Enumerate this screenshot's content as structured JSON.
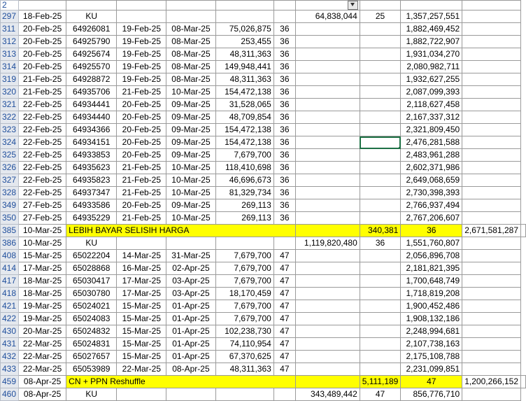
{
  "header_row": {
    "row_num": "2"
  },
  "rows": [
    {
      "num": "297",
      "c1": "18-Feb-25",
      "c2": "KU",
      "c3": "",
      "c4": "",
      "c5": "",
      "c6": "",
      "c7": "64,838,044",
      "c8": "25",
      "c9": "1,357,257,551",
      "hl": false
    },
    {
      "num": "311",
      "c1": "20-Feb-25",
      "c2": "64926081",
      "c3": "19-Feb-25",
      "c4": "08-Mar-25",
      "c5": "75,026,875",
      "c6": "36",
      "c7": "",
      "c8": "",
      "c9": "1,882,469,452",
      "hl": false
    },
    {
      "num": "312",
      "c1": "20-Feb-25",
      "c2": "64925790",
      "c3": "19-Feb-25",
      "c4": "08-Mar-25",
      "c5": "253,455",
      "c6": "36",
      "c7": "",
      "c8": "",
      "c9": "1,882,722,907",
      "hl": false
    },
    {
      "num": "313",
      "c1": "20-Feb-25",
      "c2": "64925674",
      "c3": "19-Feb-25",
      "c4": "08-Mar-25",
      "c5": "48,311,363",
      "c6": "36",
      "c7": "",
      "c8": "",
      "c9": "1,931,034,270",
      "hl": false
    },
    {
      "num": "314",
      "c1": "20-Feb-25",
      "c2": "64925570",
      "c3": "19-Feb-25",
      "c4": "08-Mar-25",
      "c5": "149,948,441",
      "c6": "36",
      "c7": "",
      "c8": "",
      "c9": "2,080,982,711",
      "hl": false
    },
    {
      "num": "319",
      "c1": "21-Feb-25",
      "c2": "64928872",
      "c3": "19-Feb-25",
      "c4": "08-Mar-25",
      "c5": "48,311,363",
      "c6": "36",
      "c7": "",
      "c8": "",
      "c9": "1,932,627,255",
      "hl": false
    },
    {
      "num": "320",
      "c1": "21-Feb-25",
      "c2": "64935706",
      "c3": "21-Feb-25",
      "c4": "10-Mar-25",
      "c5": "154,472,138",
      "c6": "36",
      "c7": "",
      "c8": "",
      "c9": "2,087,099,393",
      "hl": false
    },
    {
      "num": "321",
      "c1": "22-Feb-25",
      "c2": "64934441",
      "c3": "20-Feb-25",
      "c4": "09-Mar-25",
      "c5": "31,528,065",
      "c6": "36",
      "c7": "",
      "c8": "",
      "c9": "2,118,627,458",
      "hl": false
    },
    {
      "num": "322",
      "c1": "22-Feb-25",
      "c2": "64934440",
      "c3": "20-Feb-25",
      "c4": "09-Mar-25",
      "c5": "48,709,854",
      "c6": "36",
      "c7": "",
      "c8": "",
      "c9": "2,167,337,312",
      "hl": false
    },
    {
      "num": "323",
      "c1": "22-Feb-25",
      "c2": "64934366",
      "c3": "20-Feb-25",
      "c4": "09-Mar-25",
      "c5": "154,472,138",
      "c6": "36",
      "c7": "",
      "c8": "",
      "c9": "2,321,809,450",
      "hl": false
    },
    {
      "num": "324",
      "c1": "22-Feb-25",
      "c2": "64934151",
      "c3": "20-Feb-25",
      "c4": "09-Mar-25",
      "c5": "154,472,138",
      "c6": "36",
      "c7": "",
      "c8": "",
      "c9": "2,476,281,588",
      "hl": false,
      "sel": true
    },
    {
      "num": "325",
      "c1": "22-Feb-25",
      "c2": "64933853",
      "c3": "20-Feb-25",
      "c4": "09-Mar-25",
      "c5": "7,679,700",
      "c6": "36",
      "c7": "",
      "c8": "",
      "c9": "2,483,961,288",
      "hl": false
    },
    {
      "num": "326",
      "c1": "22-Feb-25",
      "c2": "64935623",
      "c3": "21-Feb-25",
      "c4": "10-Mar-25",
      "c5": "118,410,698",
      "c6": "36",
      "c7": "",
      "c8": "",
      "c9": "2,602,371,986",
      "hl": false
    },
    {
      "num": "327",
      "c1": "22-Feb-25",
      "c2": "64935823",
      "c3": "21-Feb-25",
      "c4": "10-Mar-25",
      "c5": "46,696,673",
      "c6": "36",
      "c7": "",
      "c8": "",
      "c9": "2,649,068,659",
      "hl": false
    },
    {
      "num": "328",
      "c1": "22-Feb-25",
      "c2": "64937347",
      "c3": "21-Feb-25",
      "c4": "10-Mar-25",
      "c5": "81,329,734",
      "c6": "36",
      "c7": "",
      "c8": "",
      "c9": "2,730,398,393",
      "hl": false
    },
    {
      "num": "349",
      "c1": "27-Feb-25",
      "c2": "64933586",
      "c3": "20-Feb-25",
      "c4": "09-Mar-25",
      "c5": "269,113",
      "c6": "36",
      "c7": "",
      "c8": "",
      "c9": "2,766,937,494",
      "hl": false
    },
    {
      "num": "350",
      "c1": "27-Feb-25",
      "c2": "64935229",
      "c3": "21-Feb-25",
      "c4": "10-Mar-25",
      "c5": "269,113",
      "c6": "36",
      "c7": "",
      "c8": "",
      "c9": "2,767,206,607",
      "hl": false
    },
    {
      "num": "385",
      "c1": "10-Mar-25",
      "c2": "LEBIH BAYAR SELISIH HARGA",
      "c3": "",
      "c4": "",
      "c5": "",
      "c6": "",
      "c7": "340,381",
      "c8": "36",
      "c9": "2,671,581,287",
      "hl": true
    },
    {
      "num": "386",
      "c1": "10-Mar-25",
      "c2": "KU",
      "c3": "",
      "c4": "",
      "c5": "",
      "c6": "",
      "c7": "1,119,820,480",
      "c8": "36",
      "c9": "1,551,760,807",
      "hl": false
    },
    {
      "num": "408",
      "c1": "15-Mar-25",
      "c2": "65022204",
      "c3": "14-Mar-25",
      "c4": "31-Mar-25",
      "c5": "7,679,700",
      "c6": "47",
      "c7": "",
      "c8": "",
      "c9": "2,056,896,708",
      "hl": false
    },
    {
      "num": "414",
      "c1": "17-Mar-25",
      "c2": "65028868",
      "c3": "16-Mar-25",
      "c4": "02-Apr-25",
      "c5": "7,679,700",
      "c6": "47",
      "c7": "",
      "c8": "",
      "c9": "2,181,821,395",
      "hl": false
    },
    {
      "num": "417",
      "c1": "18-Mar-25",
      "c2": "65030417",
      "c3": "17-Mar-25",
      "c4": "03-Apr-25",
      "c5": "7,679,700",
      "c6": "47",
      "c7": "",
      "c8": "",
      "c9": "1,700,648,749",
      "hl": false
    },
    {
      "num": "418",
      "c1": "18-Mar-25",
      "c2": "65030780",
      "c3": "17-Mar-25",
      "c4": "03-Apr-25",
      "c5": "18,170,459",
      "c6": "47",
      "c7": "",
      "c8": "",
      "c9": "1,718,819,208",
      "hl": false
    },
    {
      "num": "421",
      "c1": "19-Mar-25",
      "c2": "65024021",
      "c3": "15-Mar-25",
      "c4": "01-Apr-25",
      "c5": "7,679,700",
      "c6": "47",
      "c7": "",
      "c8": "",
      "c9": "1,900,452,486",
      "hl": false
    },
    {
      "num": "422",
      "c1": "19-Mar-25",
      "c2": "65024083",
      "c3": "15-Mar-25",
      "c4": "01-Apr-25",
      "c5": "7,679,700",
      "c6": "47",
      "c7": "",
      "c8": "",
      "c9": "1,908,132,186",
      "hl": false
    },
    {
      "num": "430",
      "c1": "20-Mar-25",
      "c2": "65024832",
      "c3": "15-Mar-25",
      "c4": "01-Apr-25",
      "c5": "102,238,730",
      "c6": "47",
      "c7": "",
      "c8": "",
      "c9": "2,248,994,681",
      "hl": false
    },
    {
      "num": "431",
      "c1": "22-Mar-25",
      "c2": "65024831",
      "c3": "15-Mar-25",
      "c4": "01-Apr-25",
      "c5": "74,110,954",
      "c6": "47",
      "c7": "",
      "c8": "",
      "c9": "2,107,738,163",
      "hl": false
    },
    {
      "num": "432",
      "c1": "22-Mar-25",
      "c2": "65027657",
      "c3": "15-Mar-25",
      "c4": "01-Apr-25",
      "c5": "67,370,625",
      "c6": "47",
      "c7": "",
      "c8": "",
      "c9": "2,175,108,788",
      "hl": false
    },
    {
      "num": "433",
      "c1": "22-Mar-25",
      "c2": "65053989",
      "c3": "22-Mar-25",
      "c4": "08-Apr-25",
      "c5": "48,311,363",
      "c6": "47",
      "c7": "",
      "c8": "",
      "c9": "2,231,099,851",
      "hl": false
    },
    {
      "num": "459",
      "c1": "08-Apr-25",
      "c2": "CN + PPN Reshuffle",
      "c3": "",
      "c4": "",
      "c5": "",
      "c6": "",
      "c7": "5,111,189",
      "c8": "47",
      "c9": "1,200,266,152",
      "hl": true
    },
    {
      "num": "460",
      "c1": "08-Apr-25",
      "c2": "KU",
      "c3": "",
      "c4": "",
      "c5": "",
      "c6": "",
      "c7": "343,489,442",
      "c8": "47",
      "c9": "856,776,710",
      "hl": false
    }
  ]
}
